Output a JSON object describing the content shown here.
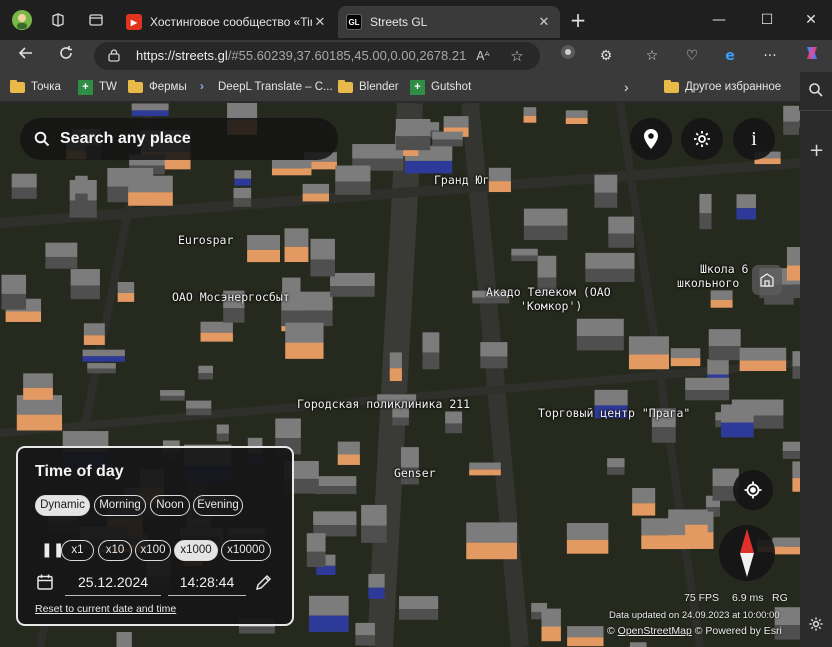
{
  "tabs": [
    {
      "title": "Хостинговое сообщество «Timeweb»",
      "favicon": "youtube-red-icon"
    },
    {
      "title": "Streets GL",
      "favicon": "GL"
    }
  ],
  "address_bar": {
    "url_host": "https://streets.gl",
    "url_rest": "/#55.60239,37.60185,45.00,0.00,2678.21"
  },
  "bookmarks": [
    {
      "label": "Точка",
      "icon": "folder"
    },
    {
      "label": "TW",
      "icon": "green-plus"
    },
    {
      "label": "Фермы",
      "icon": "folder"
    },
    {
      "label": "DeepL Translate – C...",
      "icon": "deepl"
    },
    {
      "label": "Blender",
      "icon": "folder"
    },
    {
      "label": "Gutshot",
      "icon": "green-plus"
    },
    {
      "label": "Другое избранное",
      "icon": "folder"
    }
  ],
  "search": {
    "placeholder": "Search any place"
  },
  "map_labels": [
    "Гранд Юг",
    "Eurospar",
    "ОАО Мосэнергосбыт",
    "Акадо Телеком (ОАО",
    "'Комкор')",
    "Школа 6",
    "школьного",
    "Городская поликлиника 211",
    "Торговый центр \"Прага\"",
    "Genser"
  ],
  "time_of_day": {
    "title": "Time of day",
    "modes": [
      "Dynamic",
      "Morning",
      "Noon",
      "Evening"
    ],
    "selected_mode": "Dynamic",
    "speeds": [
      "x1",
      "x10",
      "x100",
      "x1000",
      "x10000"
    ],
    "selected_speed": "x1000",
    "date": "25.12.2024",
    "time": "14:28:44",
    "reset_link": "Reset to current date and time"
  },
  "stats": {
    "fps": "75 FPS",
    "ms": "6.9 ms",
    "renderer": "RG",
    "data_updated": "Data updated on 24.09.2023 at 10:00:00",
    "copyright": "©",
    "osm_link": "OpenStreetMap",
    "powered": "© Powered by Esri"
  },
  "colors": {
    "accent_compass_red": "#e0302c",
    "building_lit": "#f0a06a",
    "map_ground": "#26281f"
  }
}
